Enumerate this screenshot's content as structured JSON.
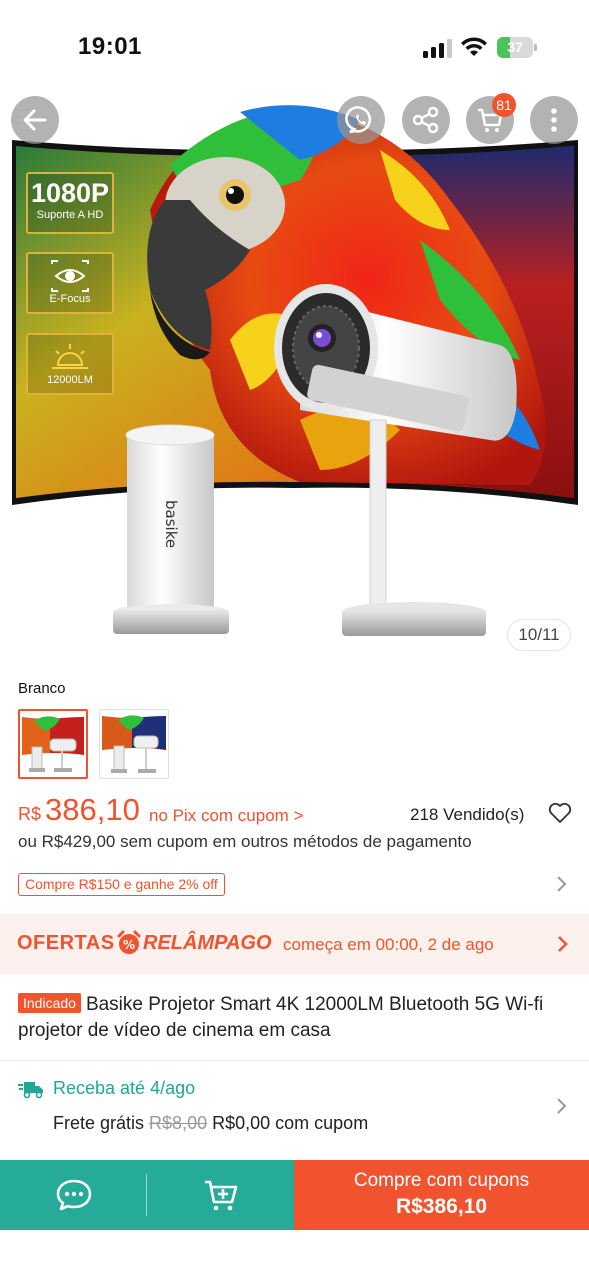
{
  "status_bar": {
    "time": "19:01",
    "battery": "37",
    "battery_level": 0.37
  },
  "header": {
    "cart_count": "81"
  },
  "hero": {
    "image_counter": "10/11",
    "features": [
      {
        "big": "1080P",
        "small": "Suporte A HD"
      },
      {
        "big": "",
        "small": "E-Focus"
      },
      {
        "big": "",
        "small": "12000LM"
      }
    ],
    "device_brand": "basike"
  },
  "variant": {
    "label": "Branco"
  },
  "price": {
    "currency": "R$",
    "value": "386,10",
    "note": "no Pix com cupom >",
    "sold": "218 Vendido(s)",
    "alt": "ou R$429,00 sem cupom em outros métodos de pagamento",
    "promo": "Compre R$150 e ganhe 2% off"
  },
  "flash_sale": {
    "ofertas": "OFERTAS",
    "relampago": "RELÂMPAGO",
    "starts": "começa em 00:00, 2 de ago"
  },
  "product": {
    "badge": "Indicado",
    "title": "Basike Projetor Smart 4K 12000LM Bluetooth 5G Wi-fi projetor de vídeo de cinema em casa"
  },
  "delivery": {
    "eta": "Receba até 4/ago",
    "shipping_label": "Frete grátis",
    "old_price": "R$8,00",
    "new_price": "R$0,00 com cupom"
  },
  "bottom_bar": {
    "buy_label": "Compre com cupons",
    "buy_price": "R$386,10"
  },
  "colors": {
    "accent": "#f0532d",
    "teal": "#26ab98",
    "teal_text": "#22a695"
  },
  "icons": [
    "back-arrow-icon",
    "whatsapp-icon",
    "share-icon",
    "cart-icon",
    "more-icon",
    "heart-icon",
    "alarm-clock-icon",
    "truck-icon",
    "chat-icon",
    "add-to-cart-icon",
    "chevron-right-icon"
  ]
}
